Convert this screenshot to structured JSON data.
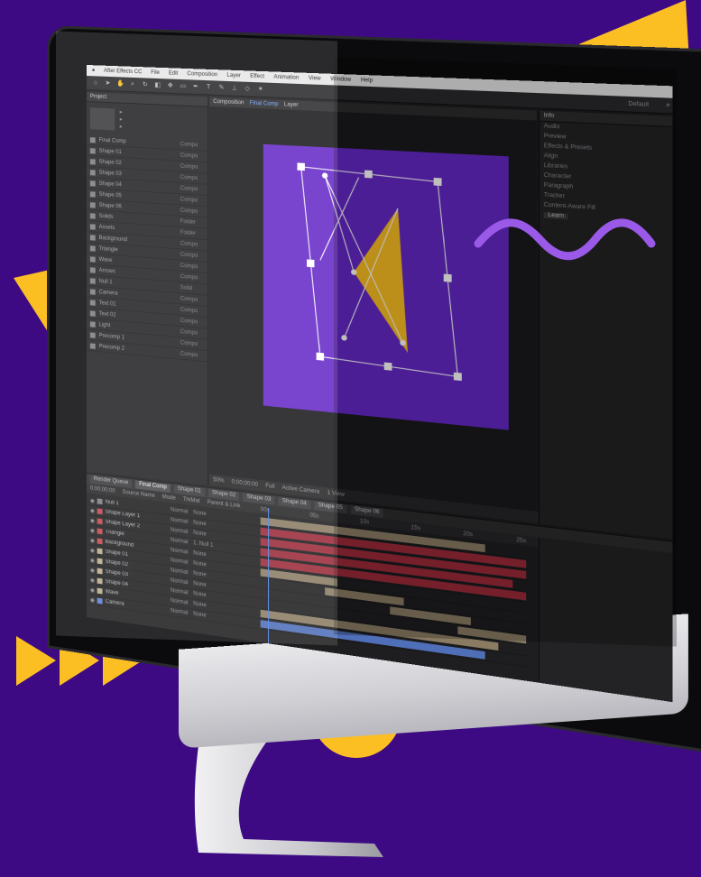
{
  "colors": {
    "background": "#3d0a84",
    "accent_yellow": "#fbbf24",
    "wave": "#9b59e8",
    "canvas": "#6e2fd0",
    "layer_red": "#9c2a3a",
    "layer_tan": "#8a7c63",
    "layer_blue": "#4f6fb8"
  },
  "app": {
    "menu": [
      "After Effects CC",
      "File",
      "Edit",
      "Composition",
      "Layer",
      "Effect",
      "Animation",
      "View",
      "Window",
      "Help"
    ],
    "workspace": "Default",
    "project_tab": "Project",
    "comp_tab": "Composition",
    "comp_tab_active": "Final Comp",
    "comp_tab_other": "Layer",
    "comp_footer": [
      "50%",
      "0;00;00;00",
      "Full",
      "Active Camera",
      "1 View"
    ],
    "right_panel_tab": "Info",
    "right_panel_rows": [
      "Audio",
      "Preview",
      "Effects & Presets",
      "Align",
      "Libraries",
      "Character",
      "Paragraph",
      "Tracker",
      "Content-Aware Fill"
    ],
    "right_panel_button": "Learn",
    "timeline_tabs": [
      "Render Queue",
      "Final Comp",
      "Shape 01",
      "Shape 02",
      "Shape 03",
      "Shape 04",
      "Shape 05",
      "Shape 06"
    ],
    "timeline_header": [
      "0;00;00;00",
      "Source Name",
      "Mode",
      "TrkMat",
      "Parent & Link"
    ],
    "ruler": [
      "00s",
      "05s",
      "10s",
      "15s",
      "20s",
      "25s"
    ]
  },
  "project_items": [
    {
      "name": "Final Comp",
      "type": "Compo"
    },
    {
      "name": "Shape 01",
      "type": "Compo"
    },
    {
      "name": "Shape 02",
      "type": "Compo"
    },
    {
      "name": "Shape 03",
      "type": "Compo"
    },
    {
      "name": "Shape 04",
      "type": "Compo"
    },
    {
      "name": "Shape 05",
      "type": "Compo"
    },
    {
      "name": "Shape 06",
      "type": "Compo"
    },
    {
      "name": "Solids",
      "type": "Folder"
    },
    {
      "name": "Assets",
      "type": "Folder"
    },
    {
      "name": "Background",
      "type": "Compo"
    },
    {
      "name": "Triangle",
      "type": "Compo"
    },
    {
      "name": "Wave",
      "type": "Compo"
    },
    {
      "name": "Arrows",
      "type": "Compo"
    },
    {
      "name": "Null 1",
      "type": "Solid"
    },
    {
      "name": "Camera",
      "type": "Compo"
    },
    {
      "name": "Text 01",
      "type": "Compo"
    },
    {
      "name": "Text 02",
      "type": "Compo"
    },
    {
      "name": "Light",
      "type": "Compo"
    },
    {
      "name": "Precomp 1",
      "type": "Compo"
    },
    {
      "name": "Precomp 2",
      "type": "Compo"
    }
  ],
  "layers": [
    {
      "name": "Null 1",
      "mode": "Normal",
      "parent": "None",
      "color": "#7d7d82"
    },
    {
      "name": "Shape Layer 1",
      "mode": "Normal",
      "parent": "None",
      "color": "#c2454f"
    },
    {
      "name": "Shape Layer 2",
      "mode": "Normal",
      "parent": "None",
      "color": "#c2454f"
    },
    {
      "name": "Triangle",
      "mode": "Normal",
      "parent": "1. Null 1",
      "color": "#c2454f"
    },
    {
      "name": "Background",
      "mode": "Normal",
      "parent": "None",
      "color": "#c2454f"
    },
    {
      "name": "Shape 01",
      "mode": "Normal",
      "parent": "None",
      "color": "#b8a989"
    },
    {
      "name": "Shape 02",
      "mode": "Normal",
      "parent": "None",
      "color": "#b8a989"
    },
    {
      "name": "Shape 03",
      "mode": "Normal",
      "parent": "None",
      "color": "#b8a989"
    },
    {
      "name": "Shape 04",
      "mode": "Normal",
      "parent": "None",
      "color": "#b8a989"
    },
    {
      "name": "Wave",
      "mode": "Normal",
      "parent": "None",
      "color": "#b8a989"
    },
    {
      "name": "Camera",
      "mode": "Normal",
      "parent": "None",
      "color": "#5c7fd1"
    }
  ],
  "track_bars": [
    {
      "color": "#8a7c63",
      "start": 0.0,
      "end": 0.85
    },
    {
      "color": "#9c2a3a",
      "start": 0.0,
      "end": 1.0
    },
    {
      "color": "#9c2a3a",
      "start": 0.0,
      "end": 1.0
    },
    {
      "color": "#9c2a3a",
      "start": 0.0,
      "end": 0.95
    },
    {
      "color": "#9c2a3a",
      "start": 0.0,
      "end": 1.0
    },
    {
      "color": "#8a7c63",
      "start": 0.0,
      "end": 0.3
    },
    {
      "color": "#8a7c63",
      "start": 0.25,
      "end": 0.55
    },
    {
      "color": "#8a7c63",
      "start": 0.5,
      "end": 0.8
    },
    {
      "color": "#8a7c63",
      "start": 0.75,
      "end": 1.0
    },
    {
      "color": "#8a7c63",
      "start": 0.0,
      "end": 0.9
    },
    {
      "color": "#4f6fb8",
      "start": 0.0,
      "end": 0.85
    }
  ]
}
